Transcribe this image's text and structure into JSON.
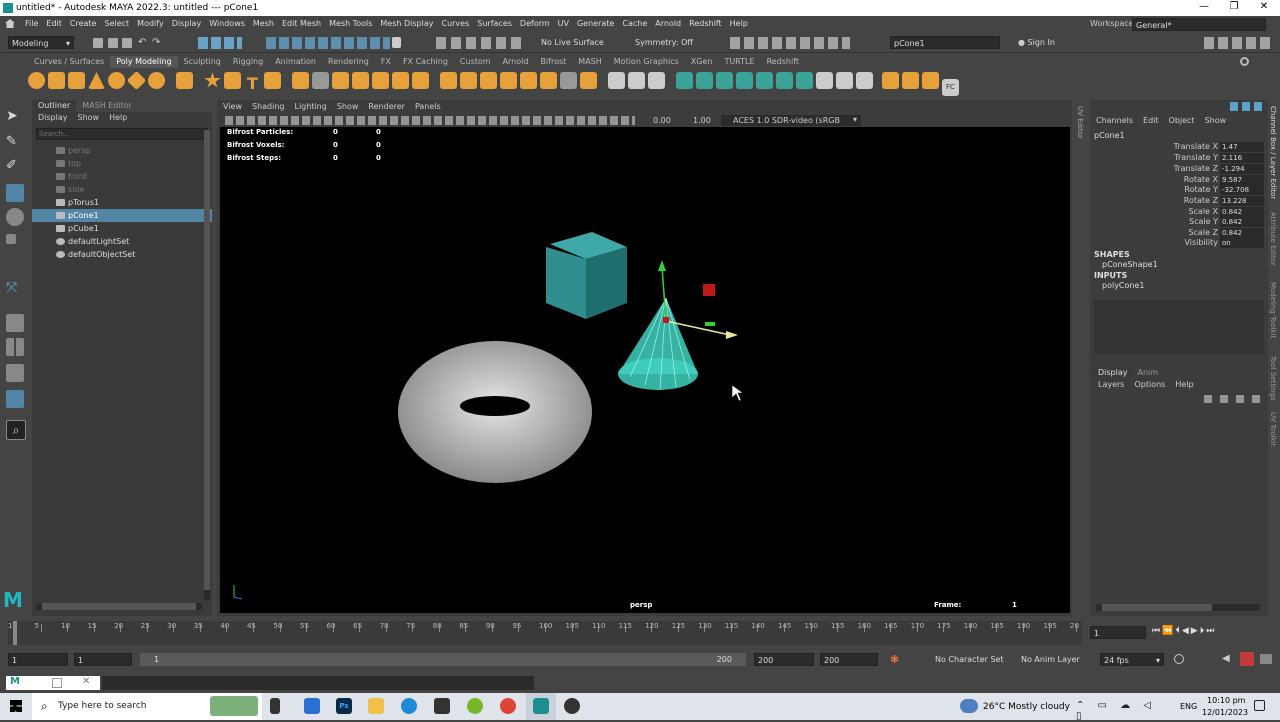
{
  "window": {
    "title": "untitled* - Autodesk MAYA 2022.3: untitled   ---   pCone1",
    "minimize": "—",
    "maximize": "❐",
    "close": "✕"
  },
  "menubar": [
    "File",
    "Edit",
    "Create",
    "Select",
    "Modify",
    "Display",
    "Windows",
    "Mesh",
    "Edit Mesh",
    "Mesh Tools",
    "Mesh Display",
    "Curves",
    "Surfaces",
    "Deform",
    "UV",
    "Generate",
    "Cache",
    "Arnold",
    "Redshift",
    "Help"
  ],
  "workspace": {
    "label": "Workspace:",
    "value": "General*"
  },
  "statusline": {
    "mode": "Modeling",
    "live_surface": "No Live Surface",
    "symmetry": "Symmetry: Off",
    "object_field": "pCone1",
    "sign_in": "Sign In"
  },
  "shelf_tabs": [
    "Curves / Surfaces",
    "Poly Modeling",
    "Sculpting",
    "Rigging",
    "Animation",
    "Rendering",
    "FX",
    "FX Caching",
    "Custom",
    "Arnold",
    "Bifrost",
    "MASH",
    "Motion Graphics",
    "XGen",
    "TURTLE",
    "Redshift"
  ],
  "shelf_active_tab": "Poly Modeling",
  "shelf_colors": {
    "orange": "#e7a13a",
    "teal": "#3aa39a",
    "white": "#dddddd"
  },
  "outliner": {
    "tabs": [
      "Outliner",
      "MASH Editor"
    ],
    "menus": [
      "Display",
      "Show",
      "Help"
    ],
    "search_placeholder": "Search...",
    "items": [
      {
        "label": "persp",
        "state": "dim"
      },
      {
        "label": "top",
        "state": "dim"
      },
      {
        "label": "front",
        "state": "dim"
      },
      {
        "label": "side",
        "state": "dim"
      },
      {
        "label": "pTorus1",
        "state": "normal"
      },
      {
        "label": "pCone1",
        "state": "selected"
      },
      {
        "label": "pCube1",
        "state": "normal"
      },
      {
        "label": "defaultLightSet",
        "state": "normal"
      },
      {
        "label": "defaultObjectSet",
        "state": "normal"
      }
    ]
  },
  "viewport": {
    "menus": [
      "View",
      "Shading",
      "Lighting",
      "Show",
      "Renderer",
      "Panels"
    ],
    "exposure": "0.00",
    "gamma": "1.00",
    "color_space": "ACES 1.0 SDR-video (sRGB",
    "hud": [
      {
        "label": "Bifrost Particles:",
        "a": "0",
        "b": "0"
      },
      {
        "label": "Bifrost Voxels:",
        "a": "0",
        "b": "0"
      },
      {
        "label": "Bifrost Steps:",
        "a": "0",
        "b": "0"
      }
    ],
    "camera": "persp",
    "frame_label": "Frame:",
    "frame_value": "1",
    "colors": {
      "cube": "#2f8f8f",
      "cone": "#3fd1c0",
      "torus": "#bdbdbd",
      "manip_red": "#c01818"
    }
  },
  "side_tabs": [
    "UV Editor",
    "Channel Box / Layer Editor",
    "Attribute Editor",
    "Modeling Toolkit",
    "Tool Settings",
    "UV Toolkit"
  ],
  "channelbox": {
    "menus": [
      "Channels",
      "Edit",
      "Object",
      "Show"
    ],
    "object": "pCone1",
    "attrs": [
      {
        "label": "Translate X",
        "value": "1.47"
      },
      {
        "label": "Translate Y",
        "value": "2.116"
      },
      {
        "label": "Translate Z",
        "value": "-1.294"
      },
      {
        "label": "Rotate X",
        "value": "9.587"
      },
      {
        "label": "Rotate Y",
        "value": "-32.708"
      },
      {
        "label": "Rotate Z",
        "value": "13.228"
      },
      {
        "label": "Scale X",
        "value": "0.842"
      },
      {
        "label": "Scale Y",
        "value": "0.842"
      },
      {
        "label": "Scale Z",
        "value": "0.842"
      },
      {
        "label": "Visibility",
        "value": "on"
      }
    ],
    "shapes_label": "SHAPES",
    "shape": "pConeShape1",
    "inputs_label": "INPUTS",
    "input": "polyCone1",
    "layer_tabs": [
      "Display",
      "Anim"
    ],
    "layer_menus": [
      "Layers",
      "Options",
      "Help"
    ]
  },
  "timeline": {
    "ticks": [
      "1",
      "5",
      "10",
      "15",
      "20",
      "25",
      "30",
      "35",
      "40",
      "45",
      "50",
      "55",
      "60",
      "65",
      "70",
      "75",
      "80",
      "85",
      "90",
      "95",
      "100",
      "105",
      "110",
      "115",
      "120",
      "125",
      "130",
      "135",
      "140",
      "145",
      "150",
      "155",
      "160",
      "165",
      "170",
      "175",
      "180",
      "185",
      "190",
      "195",
      "20"
    ],
    "current_frame": "1"
  },
  "range": {
    "start": "1",
    "start2": "1",
    "slider_start": "1",
    "slider_end": "200",
    "end": "200",
    "end2": "200",
    "character_set": "No Character Set",
    "anim_layer": "No Anim Layer",
    "fps": "24 fps"
  },
  "taskbar": {
    "search_placeholder": "Type here to search",
    "weather": "26°C  Mostly cloudy",
    "lang": "ENG",
    "time": "10:10 pm",
    "date": "12/01/2023"
  }
}
